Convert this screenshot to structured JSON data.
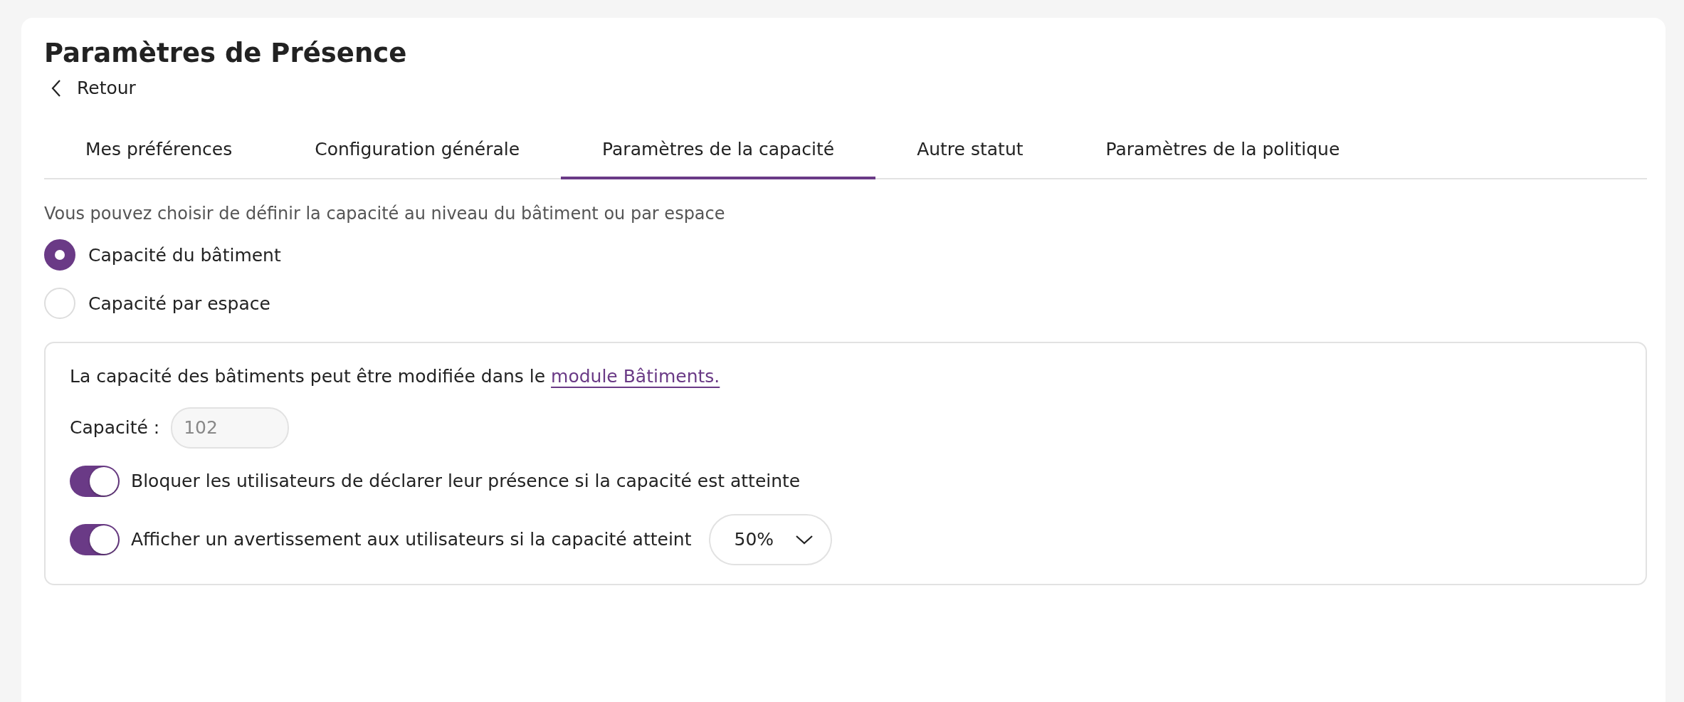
{
  "page": {
    "title": "Paramètres de Présence",
    "back_label": "Retour"
  },
  "tabs": [
    {
      "label": "Mes préférences",
      "selected": false
    },
    {
      "label": "Configuration générale",
      "selected": false
    },
    {
      "label": "Paramètres de la capacité",
      "selected": true
    },
    {
      "label": "Autre statut",
      "selected": false
    },
    {
      "label": "Paramètres de la politique",
      "selected": false
    }
  ],
  "description": "Vous pouvez choisir de définir la capacité au niveau du bâtiment ou par espace",
  "radios": [
    {
      "label": "Capacité du bâtiment",
      "selected": true
    },
    {
      "label": "Capacité par espace",
      "selected": false
    }
  ],
  "panel": {
    "info_text": "La capacité des bâtiments peut être modifiée dans le ",
    "info_link": "module Bâtiments.",
    "capacity_label": "Capacité :",
    "capacity_placeholder": "102",
    "toggles": [
      {
        "label": "Bloquer les utilisateurs de déclarer leur présence si la capacité est atteinte",
        "on": true
      },
      {
        "label": "Afficher un avertissement aux utilisateurs si la capacité atteint",
        "on": true,
        "select_value": "50%"
      }
    ]
  }
}
